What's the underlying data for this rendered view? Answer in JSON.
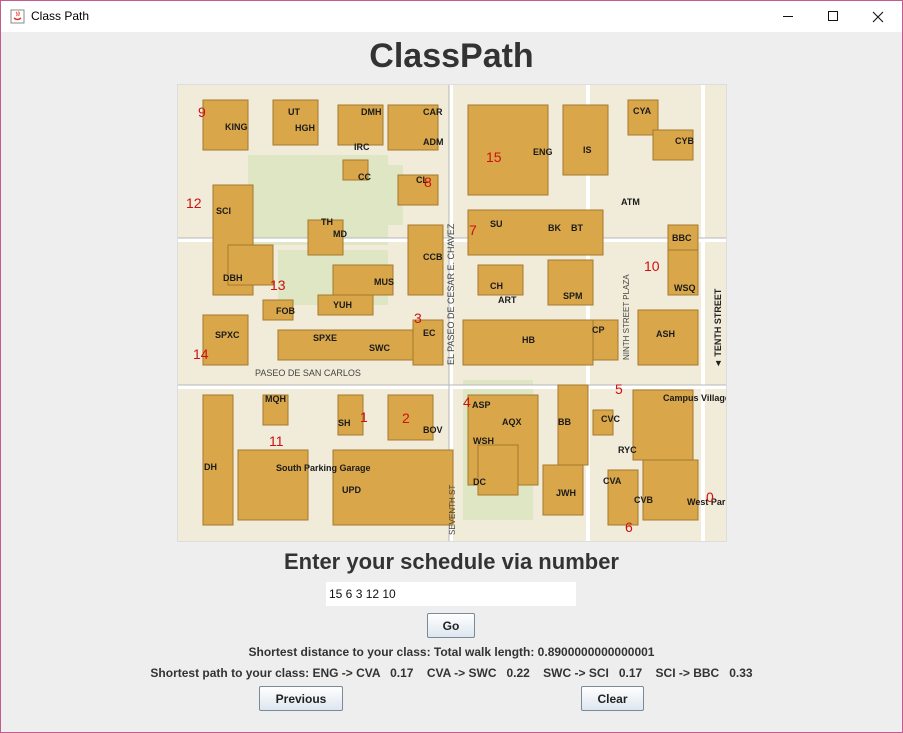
{
  "window": {
    "title": "Class Path"
  },
  "header": {
    "title": "ClassPath"
  },
  "map": {
    "street_labels": {
      "paseo_chavez": "EL PASEO DE CESAR E. CHAVEZ",
      "ninth": "NINTH STREET PLAZA",
      "tenth": "◄ TENTH STREET",
      "paseo_carlos": "PASEO DE SAN CARLOS",
      "seventh": "SEVENTH ST"
    },
    "buildings": [
      "KING",
      "UT",
      "HGH",
      "DMH",
      "IRC",
      "CAR",
      "ADM",
      "CC",
      "CL",
      "ENG",
      "IS",
      "CYA",
      "CYB",
      "ATM",
      "SCI",
      "TH",
      "MD",
      "CCB",
      "SU",
      "BK",
      "BT",
      "BBC",
      "WSQ",
      "DBH",
      "MUS",
      "CH",
      "ART",
      "SPM",
      "FOB",
      "YUH",
      "SPXC",
      "SPXE",
      "SWC",
      "EC",
      "HB",
      "CP",
      "ASH",
      "MQH",
      "SH",
      "BOV",
      "ASP",
      "AQX",
      "BB",
      "CVC",
      "Campus Village",
      "RYC",
      "WSH",
      "DC",
      "JWH",
      "CVA",
      "CVB",
      "West Parking Garage",
      "DH",
      "South Parking Garage",
      "UPD"
    ],
    "node_numbers": [
      "0",
      "1",
      "2",
      "3",
      "4",
      "5",
      "6",
      "7",
      "8",
      "9",
      "10",
      "11",
      "12",
      "13",
      "14",
      "15"
    ]
  },
  "prompt": "Enter your schedule via number",
  "schedule_input": {
    "value": "15 6 3 12 10"
  },
  "go_button": "Go",
  "distance_text": "Shortest distance to your class: Total walk length: 0.8900000000000001",
  "path_text": "Shortest path to your class: ENG -> CVA   0.17    CVA -> SWC   0.22    SWC -> SCI   0.17    SCI -> BBC   0.33",
  "previous_button": "Previous",
  "clear_button": "Clear",
  "colors": {
    "building": "#d9a74a",
    "node_number": "#cc1111",
    "map_bg": "#f1ecd9"
  }
}
